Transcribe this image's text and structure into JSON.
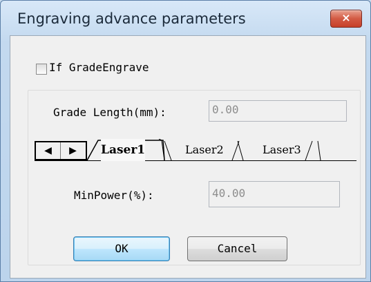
{
  "window": {
    "title": "Engraving advance parameters",
    "close_label": "×"
  },
  "grade_engrave": {
    "label": "If GradeEngrave",
    "checked": false
  },
  "grade_length": {
    "label": "Grade Length(mm):",
    "value": "0.00"
  },
  "tabs": {
    "scroll_left": "◀",
    "scroll_right": "▶",
    "items": [
      {
        "label": "Laser1",
        "active": true
      },
      {
        "label": "Laser2",
        "active": false
      },
      {
        "label": "Laser3",
        "active": false
      }
    ]
  },
  "min_power": {
    "label": "MinPower(%):",
    "value": "40.00"
  },
  "buttons": {
    "ok": "OK",
    "cancel": "Cancel"
  },
  "colors": {
    "titlebar": "#c8dcef",
    "close_button": "#d35a43",
    "client_bg": "#f0f0f0",
    "ok_border": "#3c7fb1"
  }
}
